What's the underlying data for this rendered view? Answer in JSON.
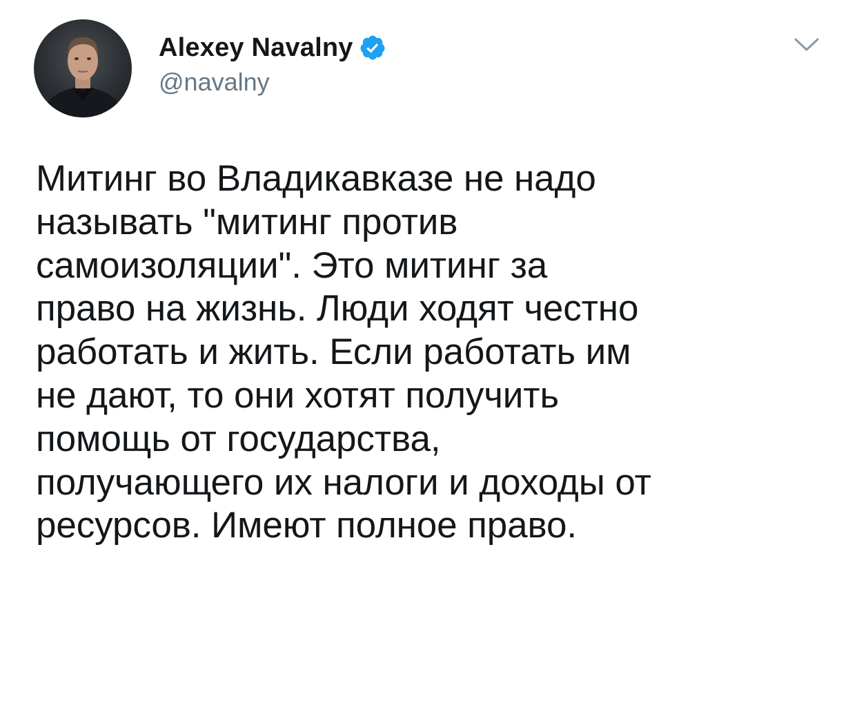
{
  "tweet": {
    "author": {
      "display_name": "Alexey Navalny",
      "handle": "@navalny",
      "verified": true,
      "avatar_icon": "user-avatar-photo"
    },
    "menu_icon": "chevron-down-icon",
    "text": "Митинг во Владикавказе не надо\nназывать \"митинг против\nсамоизоляции\". Это митинг за\nправо на жизнь. Люди ходят честно\nработать и жить. Если работать им\nне дают, то они хотят получить\nпомощь от государства,\nполучающего их налоги и доходы от\nресурсов. Имеют полное право."
  },
  "colors": {
    "text": "#14171a",
    "secondary": "#657786",
    "verified": "#1da1f2",
    "background": "#ffffff"
  }
}
